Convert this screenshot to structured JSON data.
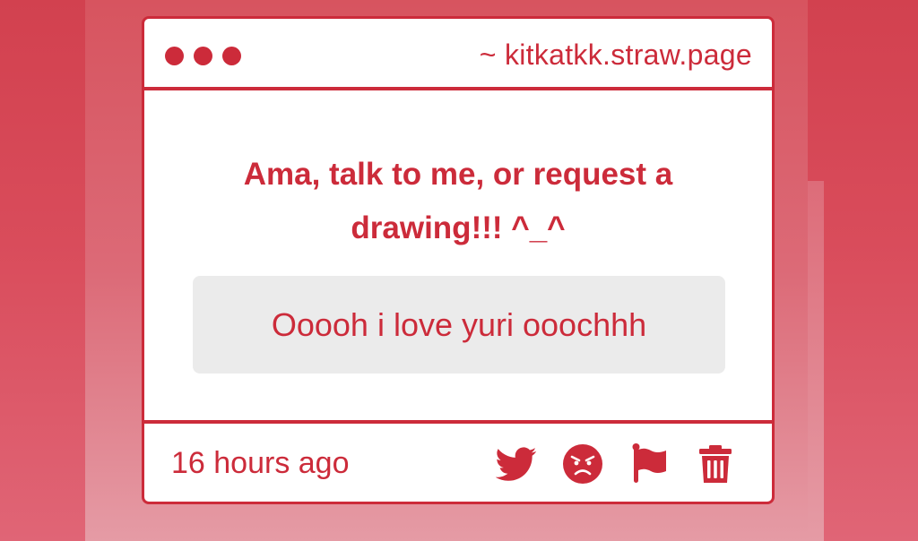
{
  "window": {
    "url": "~ kitkatkk.straw.page"
  },
  "main": {
    "prompt": "Ama, talk to me, or request a drawing!!! ^_^",
    "message": "Ooooh i love yuri ooochhh"
  },
  "footer": {
    "timestamp": "16 hours ago"
  },
  "icons": {
    "share": "twitter-icon",
    "react": "angry-face-icon",
    "report": "flag-icon",
    "delete": "trash-icon"
  },
  "colors": {
    "accent": "#cc2b3a",
    "message_bg": "#ebebeb",
    "card_bg": "#ffffff"
  }
}
